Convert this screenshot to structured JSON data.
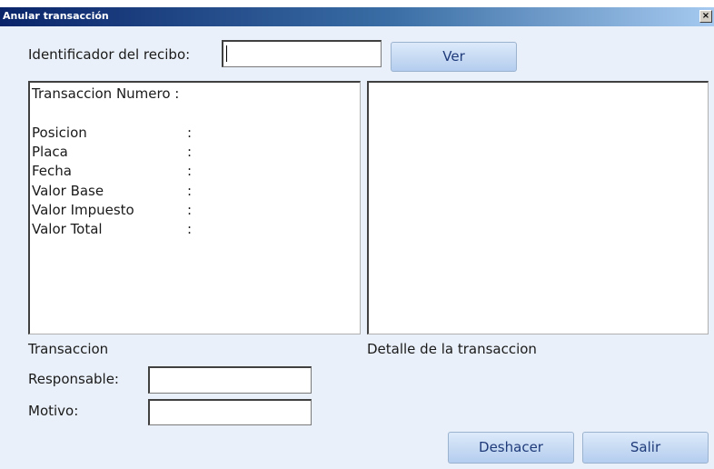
{
  "window": {
    "title": "Anular transacción",
    "close_glyph": "×"
  },
  "header": {
    "receipt_label": "Identificador del recibo:",
    "receipt_value": "",
    "view_button": "Ver"
  },
  "transaction_panel": {
    "number_label": "Transaccion Numero :",
    "fields": [
      {
        "label": "Posicion",
        "sep": ":"
      },
      {
        "label": "Placa",
        "sep": ":"
      },
      {
        "label": "Fecha",
        "sep": ":"
      },
      {
        "label": "Valor Base",
        "sep": ":"
      },
      {
        "label": "Valor Impuesto",
        "sep": ":"
      },
      {
        "label": "Valor Total",
        "sep": ":"
      }
    ],
    "caption": "Transaccion"
  },
  "detail_panel": {
    "caption": "Detalle de la transaccion"
  },
  "form": {
    "responsible_label": "Responsable:",
    "responsible_value": "",
    "reason_label": "Motivo:",
    "reason_value": ""
  },
  "actions": {
    "undo_button": "Deshacer",
    "exit_button": "Salir"
  }
}
